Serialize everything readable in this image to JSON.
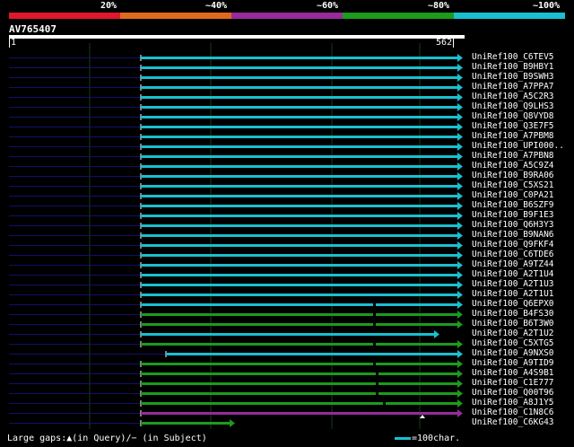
{
  "scale": {
    "labels": [
      "20%",
      "~40%",
      "~60%",
      "~80%",
      "~100%"
    ],
    "colors": [
      "#e0182b",
      "#e06a1c",
      "#972b99",
      "#1c9b1c",
      "#19c0d0"
    ]
  },
  "query": {
    "name": "AV765407",
    "start": "1",
    "end": "562"
  },
  "colors": {
    "cyan": "#19c0d0",
    "green": "#1c9b1c",
    "purple": "#972b99",
    "navy": "#10106a",
    "grid": "#1d3a1d"
  },
  "hits": [
    {
      "label": "UniRef100_C6TEV5",
      "color": "cyan"
    },
    {
      "label": "UniRef100_B9HBY1",
      "color": "cyan"
    },
    {
      "label": "UniRef100_B9SWH3",
      "color": "cyan"
    },
    {
      "label": "UniRef100_A7PPA7",
      "color": "cyan"
    },
    {
      "label": "UniRef100_A5C2R3",
      "color": "cyan"
    },
    {
      "label": "UniRef100_Q9LHS3",
      "color": "cyan"
    },
    {
      "label": "UniRef100_Q8VYD8",
      "color": "cyan"
    },
    {
      "label": "UniRef100_Q3E7F5",
      "color": "cyan"
    },
    {
      "label": "UniRef100_A7PBM8",
      "color": "cyan"
    },
    {
      "label": "UniRef100_UPI000..",
      "color": "cyan"
    },
    {
      "label": "UniRef100_A7PBN8",
      "color": "cyan"
    },
    {
      "label": "UniRef100_A5C9Z4",
      "color": "cyan"
    },
    {
      "label": "UniRef100_B9RA06",
      "color": "cyan"
    },
    {
      "label": "UniRef100_C5XS21",
      "color": "cyan"
    },
    {
      "label": "UniRef100_C0PA21",
      "color": "cyan"
    },
    {
      "label": "UniRef100_B6SZF9",
      "color": "cyan"
    },
    {
      "label": "UniRef100_B9F1E3",
      "color": "cyan"
    },
    {
      "label": "UniRef100_Q6H3Y3",
      "color": "cyan"
    },
    {
      "label": "UniRef100_B9NAN6",
      "color": "cyan"
    },
    {
      "label": "UniRef100_Q9FKF4",
      "color": "cyan"
    },
    {
      "label": "UniRef100_C6TDE6",
      "color": "cyan"
    },
    {
      "label": "UniRef100_A9TZ44",
      "color": "cyan"
    },
    {
      "label": "UniRef100_A2T1U4",
      "color": "cyan"
    },
    {
      "label": "UniRef100_A2T1U3",
      "color": "cyan"
    },
    {
      "label": "UniRef100_A2T1U1",
      "color": "cyan"
    },
    {
      "label": "UniRef100_Q6EPX0",
      "color": "cyan"
    },
    {
      "label": "UniRef100_B4FS30",
      "color": "green"
    },
    {
      "label": "UniRef100_B6T3W0",
      "color": "green"
    },
    {
      "label": "UniRef100_A2T1U2",
      "color": "cyan"
    },
    {
      "label": "UniRef100_C5XTG5",
      "color": "green"
    },
    {
      "label": "UniRef100_A9NXS0",
      "color": "cyan"
    },
    {
      "label": "UniRef100_A9TID9",
      "color": "green"
    },
    {
      "label": "UniRef100_A4S9B1",
      "color": "green"
    },
    {
      "label": "UniRef100_C1E777",
      "color": "green"
    },
    {
      "label": "UniRef100_Q00T96",
      "color": "green"
    },
    {
      "label": "UniRef100_A8J1Y5",
      "color": "green"
    },
    {
      "label": "UniRef100_C1N8C6",
      "color": "purple"
    },
    {
      "label": "UniRef100_C6KG43",
      "color": "green"
    }
  ],
  "legend": {
    "gaps": "Large gaps:▲(in Query)/− (in Subject)",
    "scale": "=100char."
  }
}
